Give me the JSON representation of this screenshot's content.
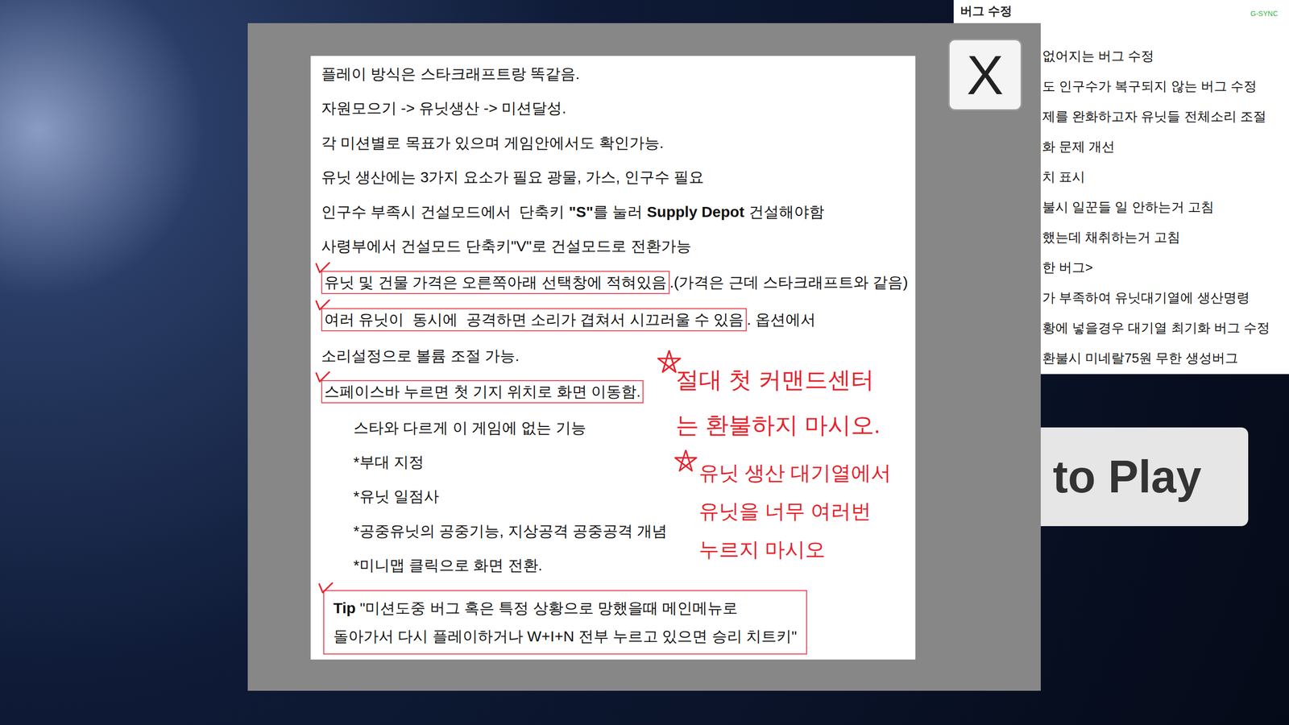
{
  "status_badge": "G-SYNC",
  "patch_notes": {
    "title": "버그 수정",
    "lines": [
      "없어지는 버그 수정",
      "도 인구수가 복구되지 않는 버그 수정",
      "제를 완화하고자 유닛들 전체소리 조절",
      "화 문제 개선",
      "치 표시",
      "불시 일꾼들 일 안하는거 고침",
      "했는데 채취하는거 고침",
      "한 버그>",
      "가 부족하여 유닛대기열에 생산명령",
      "황에 넣을경우 대기열 최기화 버그 수정",
      "환불시 미네랄75원 무한 생성버그"
    ]
  },
  "play_button": "to Play",
  "dialog": {
    "close": "X",
    "lines": [
      {
        "checked": false,
        "indent": false,
        "parts": [
          {
            "text": "플레이 방식은 스타크래프트랑 똑같음.",
            "bold": false,
            "boxed": false
          }
        ]
      },
      {
        "checked": false,
        "indent": false,
        "parts": [
          {
            "text": "자원모으기 -> 유닛생산 -> 미션달성.",
            "bold": false,
            "boxed": false
          }
        ]
      },
      {
        "checked": false,
        "indent": false,
        "parts": [
          {
            "text": "각 미션별로 목표가 있으며 게임안에서도 확인가능.",
            "bold": false,
            "boxed": false
          }
        ]
      },
      {
        "checked": false,
        "indent": false,
        "parts": [
          {
            "text": "유닛 생산에는 3가지 요소가 필요 광물, 가스, 인구수 필요",
            "bold": false,
            "boxed": false
          }
        ]
      },
      {
        "checked": false,
        "indent": false,
        "parts": [
          {
            "text": "인구수 부족시 건설모드에서  단축키 ",
            "bold": false,
            "boxed": false
          },
          {
            "text": "\"S\"",
            "bold": true,
            "boxed": false
          },
          {
            "text": "를 눌러 ",
            "bold": false,
            "boxed": false
          },
          {
            "text": "Supply Depot",
            "bold": true,
            "boxed": false
          },
          {
            "text": " 건설해야함",
            "bold": false,
            "boxed": false
          }
        ]
      },
      {
        "checked": false,
        "indent": false,
        "parts": [
          {
            "text": "사령부에서 건설모드 단축키\"V\"로 건설모드로 전환가능",
            "bold": false,
            "boxed": false
          }
        ]
      },
      {
        "checked": true,
        "indent": false,
        "parts": [
          {
            "text": "유닛 및 건물 가격은 오른쪽아래 선택창에 적혀있음",
            "bold": false,
            "boxed": true
          },
          {
            "text": ".(가격은 근데 스타크래프트와 같음)",
            "bold": false,
            "boxed": false
          }
        ]
      },
      {
        "checked": true,
        "indent": false,
        "parts": [
          {
            "text": "여러 유닛이  동시에  공격하면 소리가 겹쳐서 시끄러울 수 있음",
            "bold": false,
            "boxed": true
          },
          {
            "text": ". 옵션에서",
            "bold": false,
            "boxed": false
          }
        ]
      },
      {
        "checked": false,
        "indent": false,
        "parts": [
          {
            "text": "소리설정으로 볼륨 조절 가능.",
            "bold": false,
            "boxed": false
          }
        ]
      },
      {
        "checked": true,
        "indent": false,
        "parts": [
          {
            "text": "스페이스바 누르면 첫 기지 위치로 화면 이동함.",
            "bold": false,
            "boxed": true
          }
        ]
      },
      {
        "checked": false,
        "indent": true,
        "parts": [
          {
            "text": "스타와 다르게 이 게임에 없는 기능",
            "bold": false,
            "boxed": false
          }
        ]
      },
      {
        "checked": false,
        "indent": true,
        "parts": [
          {
            "text": "*부대 지정",
            "bold": false,
            "boxed": false
          }
        ]
      },
      {
        "checked": false,
        "indent": true,
        "parts": [
          {
            "text": "*유닛 일점사",
            "bold": false,
            "boxed": false
          }
        ]
      },
      {
        "checked": false,
        "indent": true,
        "parts": [
          {
            "text": "*공중유닛의 공중기능, 지상공격 공중공격 개념",
            "bold": false,
            "boxed": false
          }
        ]
      },
      {
        "checked": false,
        "indent": true,
        "parts": [
          {
            "text": "*미니맵 클릭으로 화면 전환.",
            "bold": false,
            "boxed": false
          }
        ]
      }
    ],
    "tip": {
      "checked": true,
      "lines": [
        [
          {
            "text": "Tip",
            "bold": true
          },
          {
            "text": " \"미션도중 버그 혹은 특정 상황으로 망했을때 메인메뉴로",
            "bold": false
          }
        ],
        [
          {
            "text": "돌아가서 다시 플레이하거나 W+I+N 전부 누르고 있으면 승리 치트키\"",
            "bold": false
          }
        ]
      ]
    },
    "notes": [
      {
        "starred": true,
        "lines": [
          "절대 첫 커맨드센터",
          "는 환불하지 마시오."
        ]
      },
      {
        "starred": true,
        "lines": [
          "유닛 생산 대기열에서",
          "유닛을 너무 여러번",
          "누르지 마시오"
        ]
      }
    ]
  }
}
